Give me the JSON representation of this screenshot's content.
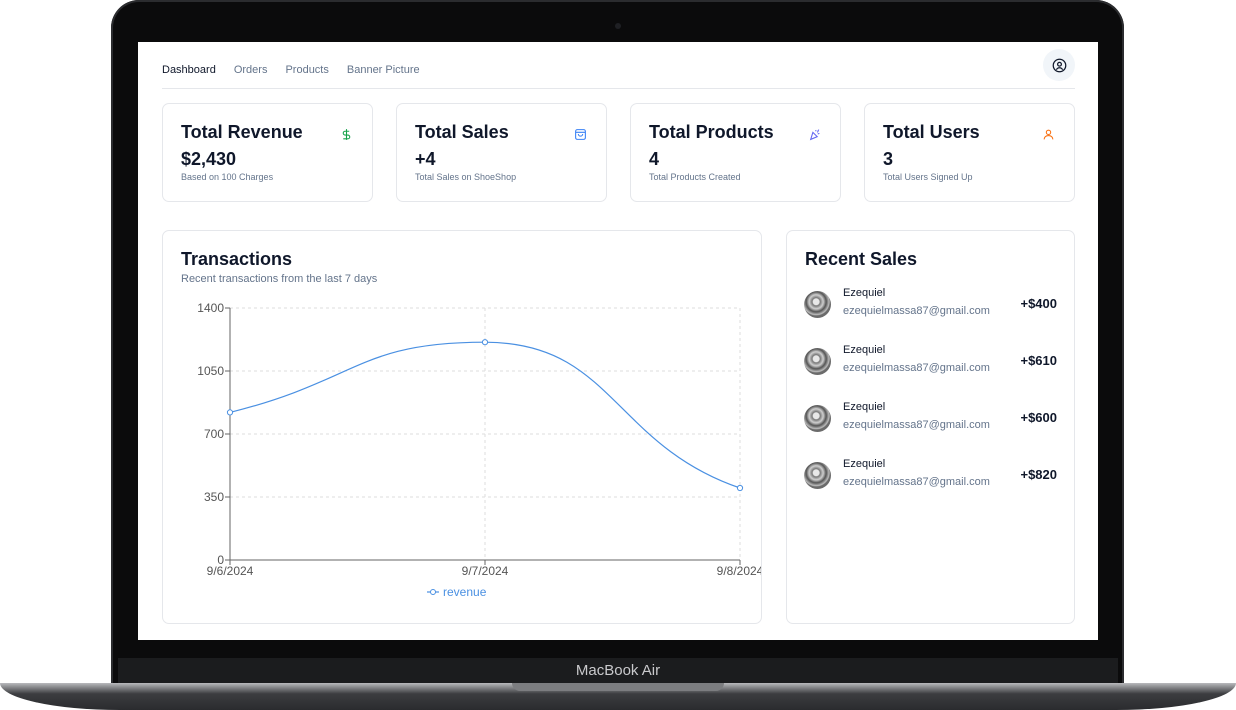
{
  "device": {
    "brand": "MacBook Air"
  },
  "nav": {
    "items": [
      {
        "label": "Dashboard",
        "active": true
      },
      {
        "label": "Orders",
        "active": false
      },
      {
        "label": "Products",
        "active": false
      },
      {
        "label": "Banner Picture",
        "active": false
      }
    ],
    "account_icon": "user-circle-icon"
  },
  "stats": [
    {
      "title": "Total Revenue",
      "value": "$2,430",
      "subtitle": "Based on 100 Charges",
      "icon": "dollar-icon",
      "icon_color": "#16a34a"
    },
    {
      "title": "Total Sales",
      "value": "+4",
      "subtitle": "Total Sales on ShoeShop",
      "icon": "shopping-bag-icon",
      "icon_color": "#3b82f6"
    },
    {
      "title": "Total Products",
      "value": "4",
      "subtitle": "Total Products Created",
      "icon": "party-popper-icon",
      "icon_color": "#6366f1"
    },
    {
      "title": "Total Users",
      "value": "3",
      "subtitle": "Total Users Signed Up",
      "icon": "user-icon",
      "icon_color": "#f97316"
    }
  ],
  "transactions": {
    "title": "Transactions",
    "subtitle": "Recent transactions from the last 7 days"
  },
  "chart_data": {
    "type": "line",
    "x": [
      "9/6/2024",
      "9/7/2024",
      "9/8/2024"
    ],
    "series": [
      {
        "name": "revenue",
        "values": [
          820,
          1210,
          400
        ],
        "color": "#4a90e2"
      }
    ],
    "yticks": [
      0,
      350,
      700,
      1050,
      1400
    ],
    "ylim": [
      0,
      1400
    ],
    "grid": true,
    "legend": "bottom-center",
    "title": "",
    "xlabel": "",
    "ylabel": ""
  },
  "recent_sales": {
    "title": "Recent Sales",
    "items": [
      {
        "name": "Ezequiel",
        "email": "ezequielmassa87@gmail.com",
        "amount": "+$400"
      },
      {
        "name": "Ezequiel",
        "email": "ezequielmassa87@gmail.com",
        "amount": "+$610"
      },
      {
        "name": "Ezequiel",
        "email": "ezequielmassa87@gmail.com",
        "amount": "+$600"
      },
      {
        "name": "Ezequiel",
        "email": "ezequielmassa87@gmail.com",
        "amount": "+$820"
      }
    ]
  }
}
